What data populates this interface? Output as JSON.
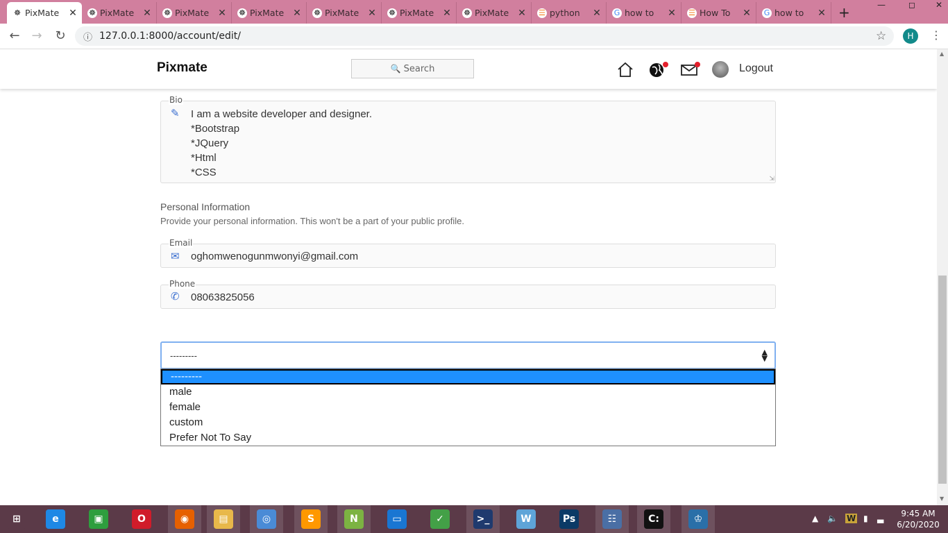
{
  "browser": {
    "tabs": [
      {
        "label": "PixMate",
        "active": true,
        "favicon": "pixmate-icon"
      },
      {
        "label": "PixMate",
        "favicon": "pixmate-icon"
      },
      {
        "label": "PixMate",
        "favicon": "pixmate-icon"
      },
      {
        "label": "PixMate",
        "favicon": "pixmate-icon"
      },
      {
        "label": "PixMate",
        "favicon": "pixmate-icon"
      },
      {
        "label": "PixMate",
        "favicon": "pixmate-icon"
      },
      {
        "label": "PixMate",
        "favicon": "pixmate-icon"
      },
      {
        "label": "python",
        "favicon": "stackoverflow-icon"
      },
      {
        "label": "how to",
        "favicon": "google-icon"
      },
      {
        "label": "How To",
        "favicon": "stackoverflow-icon"
      },
      {
        "label": "how to",
        "favicon": "google-icon"
      }
    ],
    "new_tab": "+",
    "url": "127.0.0.1:8000/account/edit/",
    "profile_initial": "H",
    "accent": "#d17f9e"
  },
  "site": {
    "brand": "Pixmate",
    "search_placeholder": "Search",
    "logout": "Logout",
    "notification_color": "#e3202c"
  },
  "form": {
    "bio": {
      "label": "Bio",
      "lines": [
        "I am a website developer and designer.",
        "*Bootstrap",
        "*JQuery",
        "*Html",
        "*CSS"
      ]
    },
    "personal": {
      "title": "Personal Information",
      "subtitle": "Provide your personal information. This won't be a part of your public profile."
    },
    "email": {
      "label": "Email",
      "value": "oghomwenogunmwonyi@gmail.com"
    },
    "phone": {
      "label": "Phone",
      "value": "08063825056"
    },
    "gender_select": {
      "value": "---------",
      "options": [
        "---------",
        "male",
        "female",
        "custom",
        "Prefer Not To Say"
      ],
      "selected_index": 0
    }
  },
  "taskbar": {
    "time": "9:45 AM",
    "date": "6/20/2020",
    "apps": [
      "windows-start-icon",
      "internet-explorer-icon",
      "store-icon",
      "opera-icon",
      "firefox-icon",
      "file-explorer-icon",
      "chrome-icon",
      "sublime-text-icon",
      "notepad-plus-icon",
      "remote-desktop-icon",
      "app-green-icon",
      "powershell-icon",
      "wireshark-icon",
      "photoshop-icon",
      "control-panel-icon",
      "cmd-icon",
      "mysql-workbench-icon"
    ]
  }
}
